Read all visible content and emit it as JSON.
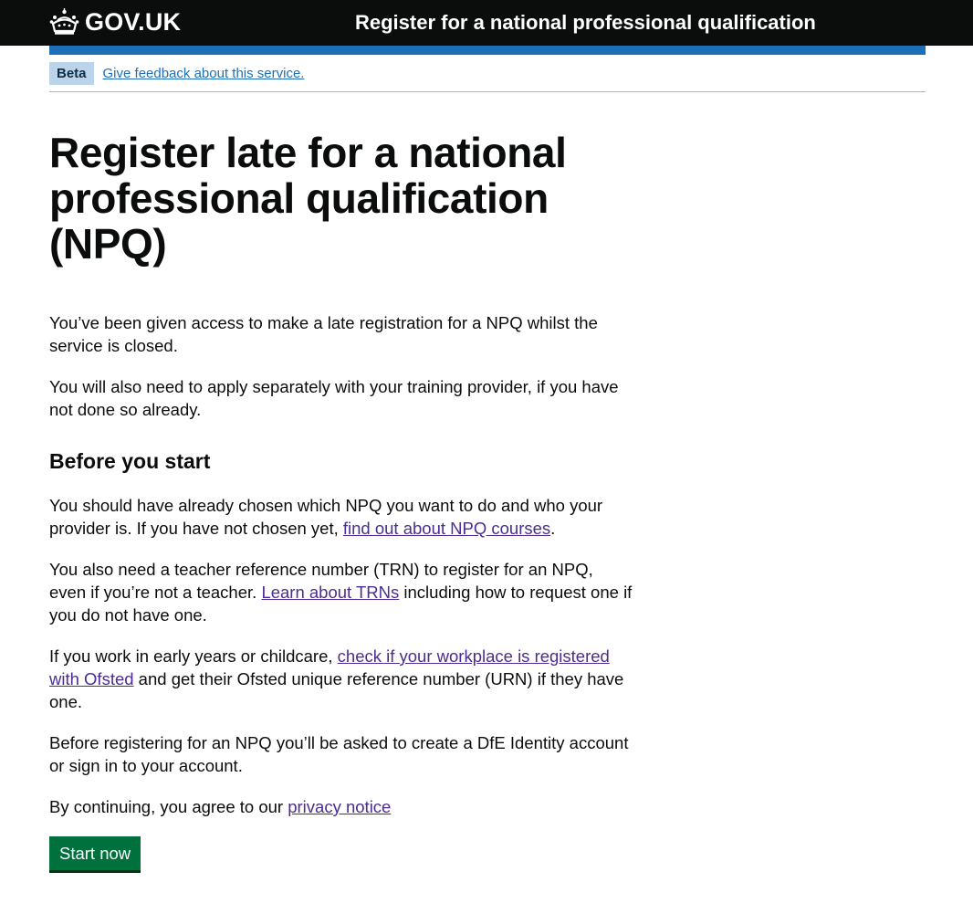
{
  "header": {
    "logo_text": "GOV.UK",
    "service_name": "Register for a national professional qualification"
  },
  "phase_banner": {
    "tag": "Beta",
    "feedback_link": "Give feedback about this service."
  },
  "main": {
    "title": "Register late for a national professional qualification (NPQ)",
    "intro": [
      "You’ve been given access to make a late registration for a NPQ whilst the service is closed.",
      "You will also need to apply separately with your training provider, if you have not done so already."
    ],
    "before_heading": "Before you start",
    "p_choose": {
      "before": "You should have already chosen which NPQ you want to do and who your provider is. If you have not chosen yet, ",
      "link": "find out about NPQ courses",
      "after": "."
    },
    "p_trn": {
      "before": "You also need a teacher reference number (TRN) to register for an NPQ, even if you’re not a teacher. ",
      "link": "Learn about TRNs",
      "after": " including how to request one if you do not have one."
    },
    "p_ofsted": {
      "before": "If you work in early years or childcare, ",
      "link": "check if your workplace is registered with Ofsted",
      "after": " and get their Ofsted unique reference number (URN) if they have one."
    },
    "p_identity": "Before registering for an NPQ you’ll be asked to create a DfE Identity account or sign in to your account.",
    "p_privacy": {
      "before": "By continuing, you agree to our ",
      "link": "privacy notice"
    },
    "start_button": "Start now"
  },
  "colors": {
    "header_bg": "#0b0c0c",
    "brand_blue": "#1d70b8",
    "link_visited": "#4c2c92",
    "button_green": "#00703c"
  }
}
